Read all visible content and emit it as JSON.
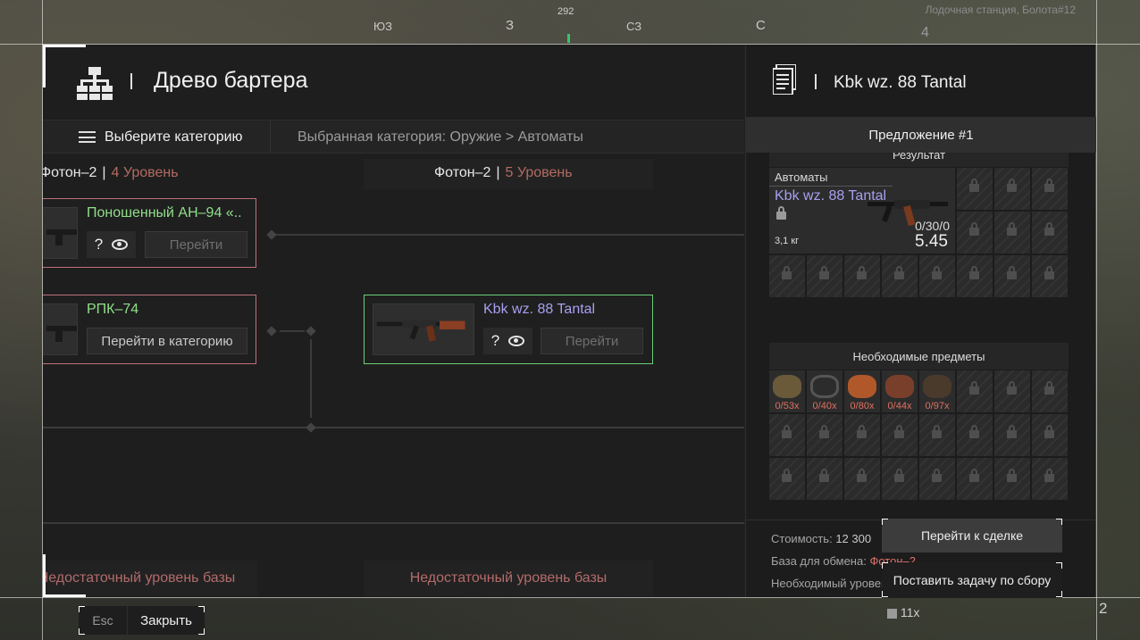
{
  "hud": {
    "location": "Лодочная станция, Болота#12",
    "compass": {
      "bearing": "292",
      "ticks": [
        "ЮЗ",
        "З",
        "СЗ",
        "С"
      ]
    },
    "side_number": "4",
    "multiplier": "11x",
    "count": "2"
  },
  "window": {
    "title": "Древо бартера",
    "category_button": "Выберите категорию",
    "category_path": "Выбранная категория: Оружие > Автоматы",
    "columns": [
      {
        "base": "Фотон–2",
        "level": "4 Уровень"
      },
      {
        "base": "Фотон–2",
        "level": "5 Уровень"
      }
    ],
    "cards": [
      {
        "title": "Поношенный АН–94 «..",
        "go": "Перейти"
      },
      {
        "title": "РПК–74",
        "go": "Перейти в категорию"
      },
      {
        "title": "Kbk wz. 88 Tantal",
        "go": "Перейти"
      }
    ],
    "footer_left": "Недостаточный уровень базы",
    "footer_right": "Недостаточный уровень базы"
  },
  "detail": {
    "title": "Kbk wz. 88 Tantal",
    "offer_tab": "Предложение #1",
    "result_label": "Результат",
    "item": {
      "category": "Автоматы",
      "name": "Kbk wz. 88 Tantal",
      "weight": "3,1 кг",
      "ammo": "0/30/0",
      "caliber": "5.45"
    },
    "required_label": "Необходимые предметы",
    "required_items": [
      {
        "count": "0/53x",
        "color": "#6a5a3a"
      },
      {
        "count": "0/40x",
        "color": "#3a3a3a"
      },
      {
        "count": "0/80x",
        "color": "#b0582a"
      },
      {
        "count": "0/44x",
        "color": "#7a3f2a"
      },
      {
        "count": "0/97x",
        "color": "#4a3a2c"
      }
    ],
    "cost_label": "Стоимость:",
    "cost_value": "12 300",
    "base_label": "База для обмена:",
    "base_value": "Фотон–2",
    "need_label": "Необходимый уровень",
    "deal_button": "Перейти к сделке",
    "task_button": "Поставить задачу по сбору"
  },
  "bottom": {
    "esc": "Esc",
    "close": "Закрыть"
  }
}
